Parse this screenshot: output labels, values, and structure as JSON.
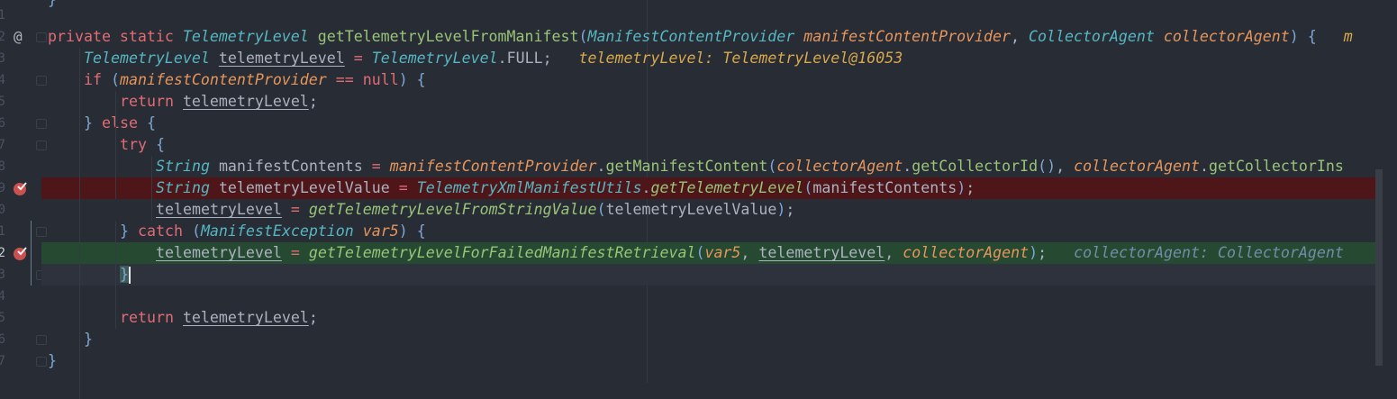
{
  "editor": {
    "line_numbers": [
      "1",
      "2",
      "3",
      "4",
      "5",
      "6",
      "7",
      "8",
      "9",
      "0",
      "1",
      "2",
      "3",
      "4",
      "5",
      "6",
      "7"
    ],
    "current_line_index": 12,
    "override_marker": "@",
    "lines": [
      {
        "indent": 1,
        "kind": "top",
        "tokens": [
          [
            "pu",
            "}"
          ]
        ]
      },
      {
        "indent": 0,
        "tokens": []
      },
      {
        "indent": 1,
        "tokens": [
          [
            "k",
            "private static "
          ],
          [
            "t",
            "TelemetryLevel"
          ],
          [
            "v",
            " "
          ],
          [
            "m",
            "getTelemetryLevelFromManifest"
          ],
          [
            "pu",
            "("
          ],
          [
            "t",
            "ManifestContentProvider"
          ],
          [
            "v",
            " "
          ],
          [
            "p",
            "manifestContentProvider"
          ],
          [
            "v",
            ", "
          ],
          [
            "t",
            "CollectorAgent"
          ],
          [
            "v",
            " "
          ],
          [
            "p",
            "collectorAgent"
          ],
          [
            "pu",
            ") {"
          ],
          [
            "v",
            "   "
          ],
          [
            "h1",
            "m"
          ]
        ]
      },
      {
        "indent": 2,
        "tokens": [
          [
            "t",
            "TelemetryLevel"
          ],
          [
            "v",
            " "
          ],
          [
            "u",
            "telemetryLevel"
          ],
          [
            "o",
            " = "
          ],
          [
            "t",
            "TelemetryLevel"
          ],
          [
            "v",
            "."
          ],
          [
            "f",
            "FULL"
          ],
          [
            "v",
            ";"
          ],
          [
            "v",
            "   "
          ],
          [
            "h1",
            "telemetryLevel: TelemetryLevel@16053"
          ]
        ]
      },
      {
        "indent": 2,
        "tokens": [
          [
            "k",
            "if "
          ],
          [
            "pu",
            "("
          ],
          [
            "p",
            "manifestContentProvider"
          ],
          [
            "o",
            " == "
          ],
          [
            "k",
            "null"
          ],
          [
            "pu",
            ") {"
          ]
        ]
      },
      {
        "indent": 3,
        "tokens": [
          [
            "k",
            "return "
          ],
          [
            "u",
            "telemetryLevel"
          ],
          [
            "v",
            ";"
          ]
        ]
      },
      {
        "indent": 2,
        "tokens": [
          [
            "pu",
            "} "
          ],
          [
            "k",
            "else "
          ],
          [
            "pu",
            "{"
          ]
        ]
      },
      {
        "indent": 3,
        "tokens": [
          [
            "k",
            "try "
          ],
          [
            "pu",
            "{"
          ]
        ]
      },
      {
        "indent": 4,
        "tokens": [
          [
            "t",
            "String"
          ],
          [
            "v",
            " manifestContents "
          ],
          [
            "o",
            "= "
          ],
          [
            "p",
            "manifestContentProvider"
          ],
          [
            "v",
            "."
          ],
          [
            "m",
            "getManifestContent"
          ],
          [
            "pu",
            "("
          ],
          [
            "p",
            "collectorAgent"
          ],
          [
            "v",
            "."
          ],
          [
            "m",
            "getCollectorId"
          ],
          [
            "pu",
            "()"
          ],
          [
            "v",
            ", "
          ],
          [
            "p",
            "collectorAgent"
          ],
          [
            "v",
            "."
          ],
          [
            "m",
            "getCollectorIns"
          ]
        ]
      },
      {
        "indent": 4,
        "kind": "bp",
        "tokens": [
          [
            "t",
            "String"
          ],
          [
            "v",
            " telemetryLevelValue "
          ],
          [
            "o",
            "= "
          ],
          [
            "t",
            "TelemetryXmlManifestUtils"
          ],
          [
            "v",
            "."
          ],
          [
            "ms",
            "getTelemetryLevel"
          ],
          [
            "pu",
            "("
          ],
          [
            "v",
            "manifestContents"
          ],
          [
            "pu",
            ")"
          ],
          [
            "v",
            ";"
          ]
        ]
      },
      {
        "indent": 4,
        "tokens": [
          [
            "u",
            "telemetryLevel"
          ],
          [
            "o",
            " = "
          ],
          [
            "ms",
            "getTelemetryLevelFromStringValue"
          ],
          [
            "pu",
            "("
          ],
          [
            "v",
            "telemetryLevelValue"
          ],
          [
            "pu",
            ")"
          ],
          [
            "v",
            ";"
          ]
        ]
      },
      {
        "indent": 3,
        "tokens": [
          [
            "pu",
            "} "
          ],
          [
            "k",
            "catch "
          ],
          [
            "pu",
            "("
          ],
          [
            "t",
            "ManifestException"
          ],
          [
            "v",
            " "
          ],
          [
            "p",
            "var5"
          ],
          [
            "pu",
            ") {"
          ]
        ]
      },
      {
        "indent": 4,
        "kind": "exec",
        "tokens": [
          [
            "u",
            "telemetryLevel"
          ],
          [
            "o",
            " = "
          ],
          [
            "ms",
            "getTelemetryLevelForFailedManifestRetrieval"
          ],
          [
            "pu",
            "("
          ],
          [
            "p",
            "var5"
          ],
          [
            "v",
            ", "
          ],
          [
            "u",
            "telemetryLevel"
          ],
          [
            "v",
            ", "
          ],
          [
            "p",
            "collectorAgent"
          ],
          [
            "pu",
            ")"
          ],
          [
            "v",
            ";"
          ],
          [
            "v",
            "   "
          ],
          [
            "h2",
            "collectorAgent: CollectorAgent"
          ]
        ]
      },
      {
        "indent": 3,
        "kind": "cur",
        "tokens": [
          [
            "caret",
            "}"
          ]
        ]
      },
      {
        "indent": 0,
        "tokens": []
      },
      {
        "indent": 3,
        "tokens": [
          [
            "k",
            "return "
          ],
          [
            "u",
            "telemetryLevel"
          ],
          [
            "v",
            ";"
          ]
        ]
      },
      {
        "indent": 2,
        "tokens": [
          [
            "pu",
            "}"
          ]
        ]
      },
      {
        "indent": 1,
        "tokens": [
          [
            "pu",
            "}"
          ]
        ]
      }
    ]
  }
}
